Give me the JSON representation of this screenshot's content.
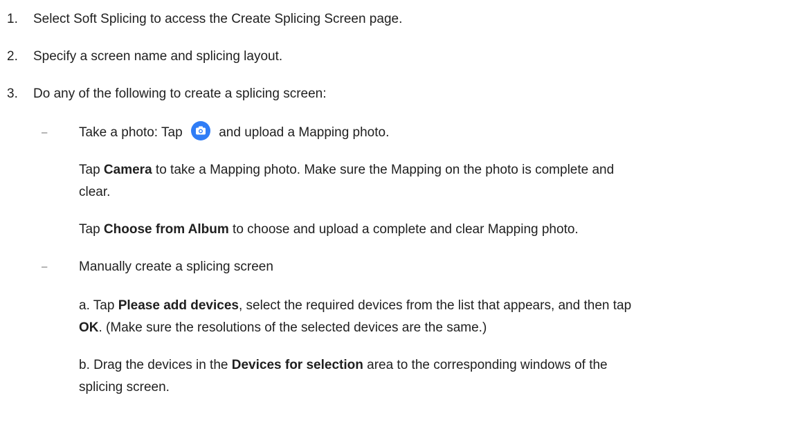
{
  "steps": [
    {
      "number": "1.",
      "text": "Select Soft Splicing to access the Create Splicing Screen page."
    },
    {
      "number": "2.",
      "text": "Specify a screen name and splicing layout."
    },
    {
      "number": "3.",
      "text": "Do any of the following to create a splicing screen:"
    }
  ],
  "bullet_mark": "–",
  "photo_option": {
    "lead": "Take a photo: Tap",
    "icon": "camera-icon",
    "icon_color": "#2f7df6",
    "tail": "and upload a Mapping photo.",
    "camera_para": {
      "pre": "Tap ",
      "bold": "Camera",
      "post_line1": " to take a Mapping photo. Make sure the Mapping on the photo is complete and",
      "line2": "clear."
    },
    "album_para": {
      "pre": "Tap ",
      "bold": "Choose from Album",
      "post": " to choose and upload a complete and clear Mapping photo."
    }
  },
  "manual_option": {
    "title": "Manually create a splicing screen",
    "step_a": {
      "pre": "a. Tap ",
      "bold1": "Please add devices",
      "mid": ", select the required devices from the list that appears, and then tap",
      "bold2": "OK",
      "post": ". (Make sure the resolutions of the selected devices are the same.)"
    },
    "step_b": {
      "pre": "b. Drag the devices in the ",
      "bold": "Devices for selection",
      "post": " area to the corresponding windows of the",
      "line2": "splicing screen."
    }
  }
}
